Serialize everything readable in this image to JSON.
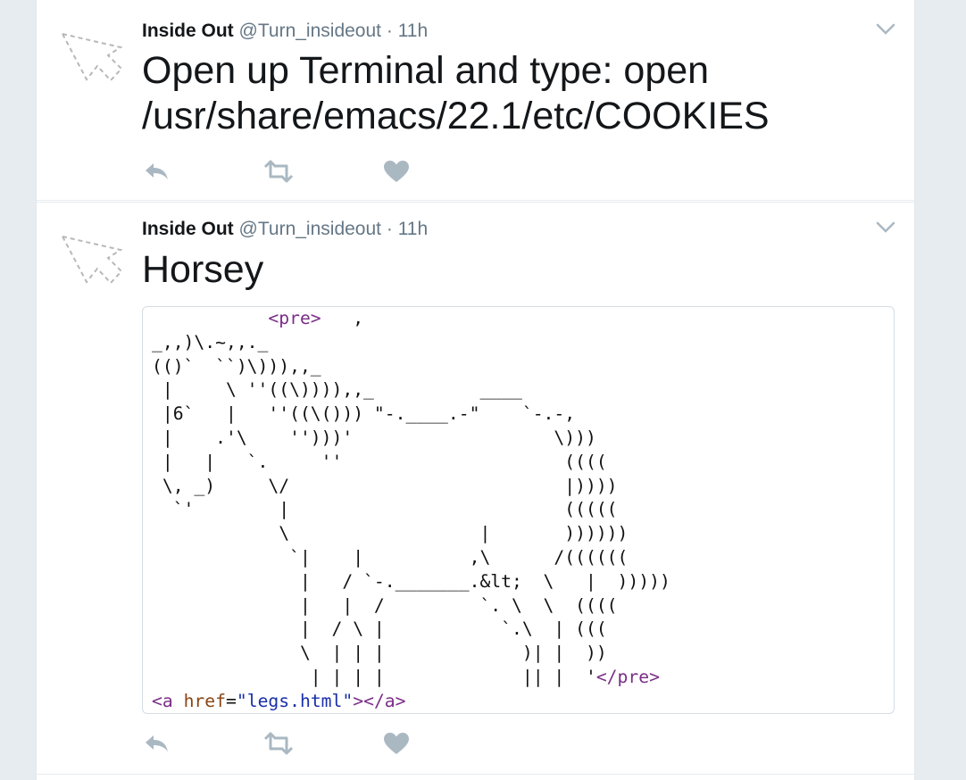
{
  "colors": {
    "background": "#e6ecf0",
    "tweet_bg": "#ffffff",
    "text": "#14171a",
    "meta": "#657786",
    "icon": "#aab8c2"
  },
  "tweets": [
    {
      "name": "Inside Out",
      "handle": "@Turn_insideout",
      "separator": "·",
      "time": "11h",
      "text": "Open up Terminal and type: open /usr/share/emacs/22.1/etc/COOKIES",
      "icons": [
        "cursor-avatar-icon",
        "chevron-down-icon",
        "reply-icon",
        "retweet-icon",
        "heart-icon"
      ]
    },
    {
      "name": "Inside Out",
      "handle": "@Turn_insideout",
      "separator": "·",
      "time": "11h",
      "text": "Horsey",
      "icons": [
        "cursor-avatar-icon",
        "chevron-down-icon",
        "reply-icon",
        "retweet-icon",
        "heart-icon"
      ],
      "card": {
        "pre_open": "<pre>",
        "pre_open_suffix": "   ,",
        "pre_close": "</pre>",
        "art_lines": [
          "_,,)\\.~,,._",
          "(()`  ``)\\))),,_",
          " |     \\ ''((\\)))),,_          ____",
          " |6`   |   ''((\\())) \"-.____.-\"    `-.-,",
          " |    .'\\    '')))'                   \\)))",
          " |   |   `.     ''                     ((((",
          " \\, _)     \\/                          |))))",
          "  `'        |                          (((((",
          "            \\                  |       ))))))",
          "             `|    |          ,\\      /((((((",
          "              |   / `-._______.&lt;  \\   |  )))))",
          "              |   |  /         `. \\  \\  ((((",
          "              |  / \\ |           `.\\  | (((",
          "              \\  | | |             )| |  ))",
          "               | | | |             || |  '"
        ],
        "anchor_open": "<a",
        "anchor_attr": "href",
        "anchor_eq": "=",
        "anchor_val": "\"legs.html\"",
        "anchor_close": "></a>"
      }
    }
  ]
}
